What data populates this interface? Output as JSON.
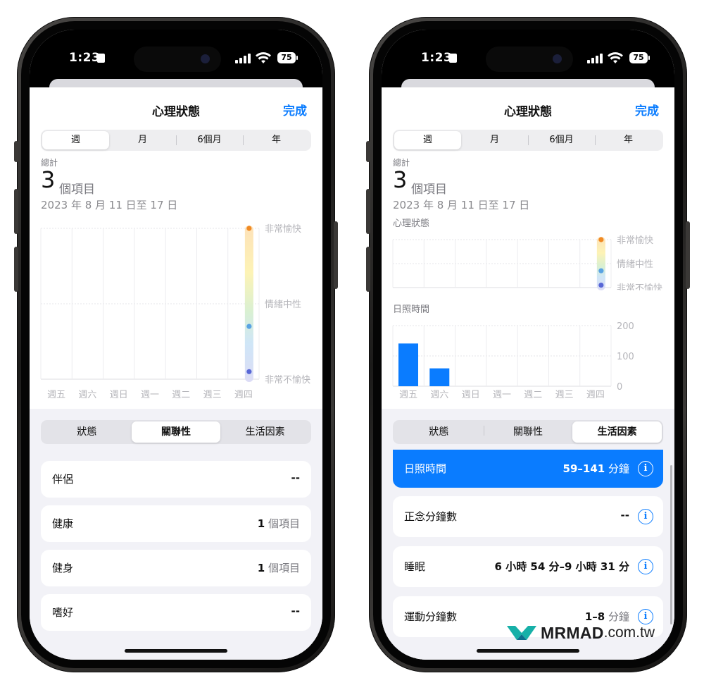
{
  "colors": {
    "accent": "#0a7cff",
    "bar": "#0a7cff"
  },
  "status": {
    "time": "1:23",
    "battery": "75"
  },
  "left": {
    "title": "心理狀態",
    "done": "完成",
    "period_tabs": [
      "週",
      "月",
      "6個月",
      "年"
    ],
    "period_active": 0,
    "total_label": "總計",
    "count": "3",
    "count_unit": "個項目",
    "date_range": "2023 年 8 月 11 日至 17 日",
    "chart_data": {
      "type": "scatter",
      "categories": [
        "週五",
        "週六",
        "週日",
        "週一",
        "週二",
        "週三",
        "週四"
      ],
      "y_levels": [
        "非常愉快",
        "情緒中性",
        "非常不愉快"
      ],
      "ylim": [
        -1,
        1
      ],
      "points": [
        {
          "x": "週四",
          "y": 1.0,
          "color": "#f08a24"
        },
        {
          "x": "週四",
          "y": -0.3,
          "color": "#59a3e3"
        },
        {
          "x": "週四",
          "y": -0.9,
          "color": "#5867d6"
        }
      ]
    },
    "sub_tabs": [
      "狀態",
      "關聯性",
      "生活因素"
    ],
    "sub_active": 1,
    "rows": [
      {
        "label": "伴侶",
        "num": "--",
        "unit": ""
      },
      {
        "label": "健康",
        "num": "1",
        "unit": "個項目"
      },
      {
        "label": "健身",
        "num": "1",
        "unit": "個項目"
      },
      {
        "label": "嗜好",
        "num": "--",
        "unit": ""
      }
    ]
  },
  "right": {
    "title": "心理狀態",
    "done": "完成",
    "period_tabs": [
      "週",
      "月",
      "6個月",
      "年"
    ],
    "period_active": 0,
    "total_label": "總計",
    "count": "3",
    "count_unit": "個項目",
    "date_range": "2023 年 8 月 11 日至 17 日",
    "mood_label": "心理狀態",
    "sun_label": "日照時間",
    "chart_data": [
      {
        "type": "scatter",
        "title": "心理狀態",
        "categories": [
          "週五",
          "週六",
          "週日",
          "週一",
          "週二",
          "週三",
          "週四"
        ],
        "y_levels": [
          "非常愉快",
          "情緒中性",
          "非常不愉快"
        ],
        "ylim": [
          -1,
          1
        ],
        "points": [
          {
            "x": "週四",
            "y": 1.0,
            "color": "#f08a24"
          },
          {
            "x": "週四",
            "y": -0.3,
            "color": "#59a3e3"
          },
          {
            "x": "週四",
            "y": -0.9,
            "color": "#5867d6"
          }
        ]
      },
      {
        "type": "bar",
        "title": "日照時間",
        "categories": [
          "週五",
          "週六",
          "週日",
          "週一",
          "週二",
          "週三",
          "週四"
        ],
        "values": [
          141,
          59,
          0,
          0,
          0,
          0,
          0
        ],
        "yticks": [
          200,
          100,
          0
        ],
        "ylim": [
          0,
          200
        ]
      }
    ],
    "sub_tabs": [
      "狀態",
      "關聯性",
      "生活因素"
    ],
    "sub_active": 2,
    "rows": [
      {
        "label": "日照時間",
        "num": "59–141",
        "unit": "分鐘",
        "selected": true
      },
      {
        "label": "正念分鐘數",
        "num": "--",
        "unit": "",
        "selected": false
      },
      {
        "label": "睡眠",
        "num": "6 小時 54 分–9 小時 31 分",
        "unit": "",
        "selected": false
      },
      {
        "label": "運動分鐘數",
        "num": "1–8",
        "unit": "分鐘",
        "selected": false
      }
    ],
    "info_glyph": "i"
  },
  "brand": {
    "name": "MRMAD",
    "domain": ".com.tw"
  }
}
